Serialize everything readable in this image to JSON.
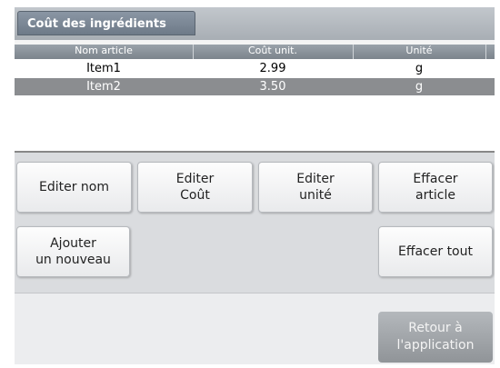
{
  "title": "Coût des ingrédients",
  "table": {
    "headers": [
      "Nom article",
      "Coût unit.",
      "Unité"
    ],
    "rows": [
      {
        "name": "Item1",
        "cost": "2.99",
        "unit": "g",
        "selected": false
      },
      {
        "name": "Item2",
        "cost": "3.50",
        "unit": "g",
        "selected": true
      }
    ]
  },
  "buttons": {
    "edit_name": "Editer nom",
    "edit_cost": "Editer\nCoût",
    "edit_unit": "Editer\nunité",
    "delete_item": "Effacer\narticle",
    "add_new": "Ajouter\nun nouveau",
    "delete_all": "Effacer tout",
    "back": "Retour à\nl'application"
  },
  "colors": {
    "selected_row": "#8b8d90",
    "title_tab": "#7a8694"
  }
}
